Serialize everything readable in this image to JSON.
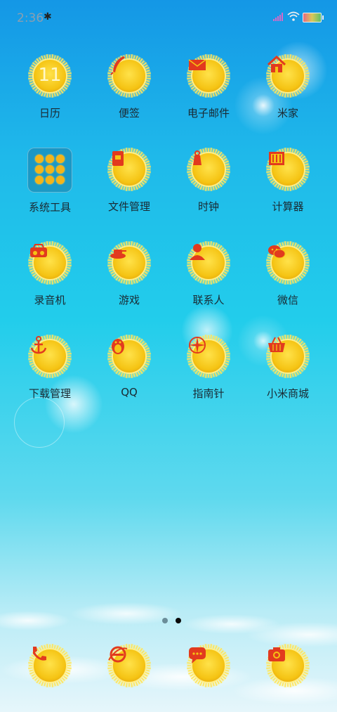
{
  "status_bar": {
    "time": "2:36",
    "bluetooth_icon": "bluetooth-icon",
    "signal_icon": "signal-icon",
    "wifi_icon": "wifi-icon",
    "battery_icon": "battery-icon"
  },
  "grid": [
    {
      "label": "日历",
      "icon": "calendar-icon",
      "badge": "11"
    },
    {
      "label": "便签",
      "icon": "feather-icon"
    },
    {
      "label": "电子邮件",
      "icon": "envelope-icon"
    },
    {
      "label": "米家",
      "icon": "home-icon"
    },
    {
      "label": "系统工具",
      "icon": "folder-icon"
    },
    {
      "label": "文件管理",
      "icon": "file-manager-icon"
    },
    {
      "label": "时钟",
      "icon": "clock-icon"
    },
    {
      "label": "计算器",
      "icon": "abacus-icon"
    },
    {
      "label": "录音机",
      "icon": "radio-icon"
    },
    {
      "label": "游戏",
      "icon": "tank-icon"
    },
    {
      "label": "联系人",
      "icon": "person-icon"
    },
    {
      "label": "微信",
      "icon": "wechat-icon"
    },
    {
      "label": "下载管理",
      "icon": "anchor-icon"
    },
    {
      "label": "QQ",
      "icon": "penguin-icon"
    },
    {
      "label": "指南针",
      "icon": "compass-icon"
    },
    {
      "label": "小米商城",
      "icon": "basket-icon"
    }
  ],
  "page_indicator": {
    "pages": 2,
    "active": 2
  },
  "dock": [
    {
      "icon": "phone-icon"
    },
    {
      "icon": "browser-icon"
    },
    {
      "icon": "message-icon"
    },
    {
      "icon": "camera-icon"
    }
  ],
  "colors": {
    "sun_core": "#f5c414",
    "sun_rim": "#ffde3a",
    "glyph": "#e23a1e"
  }
}
